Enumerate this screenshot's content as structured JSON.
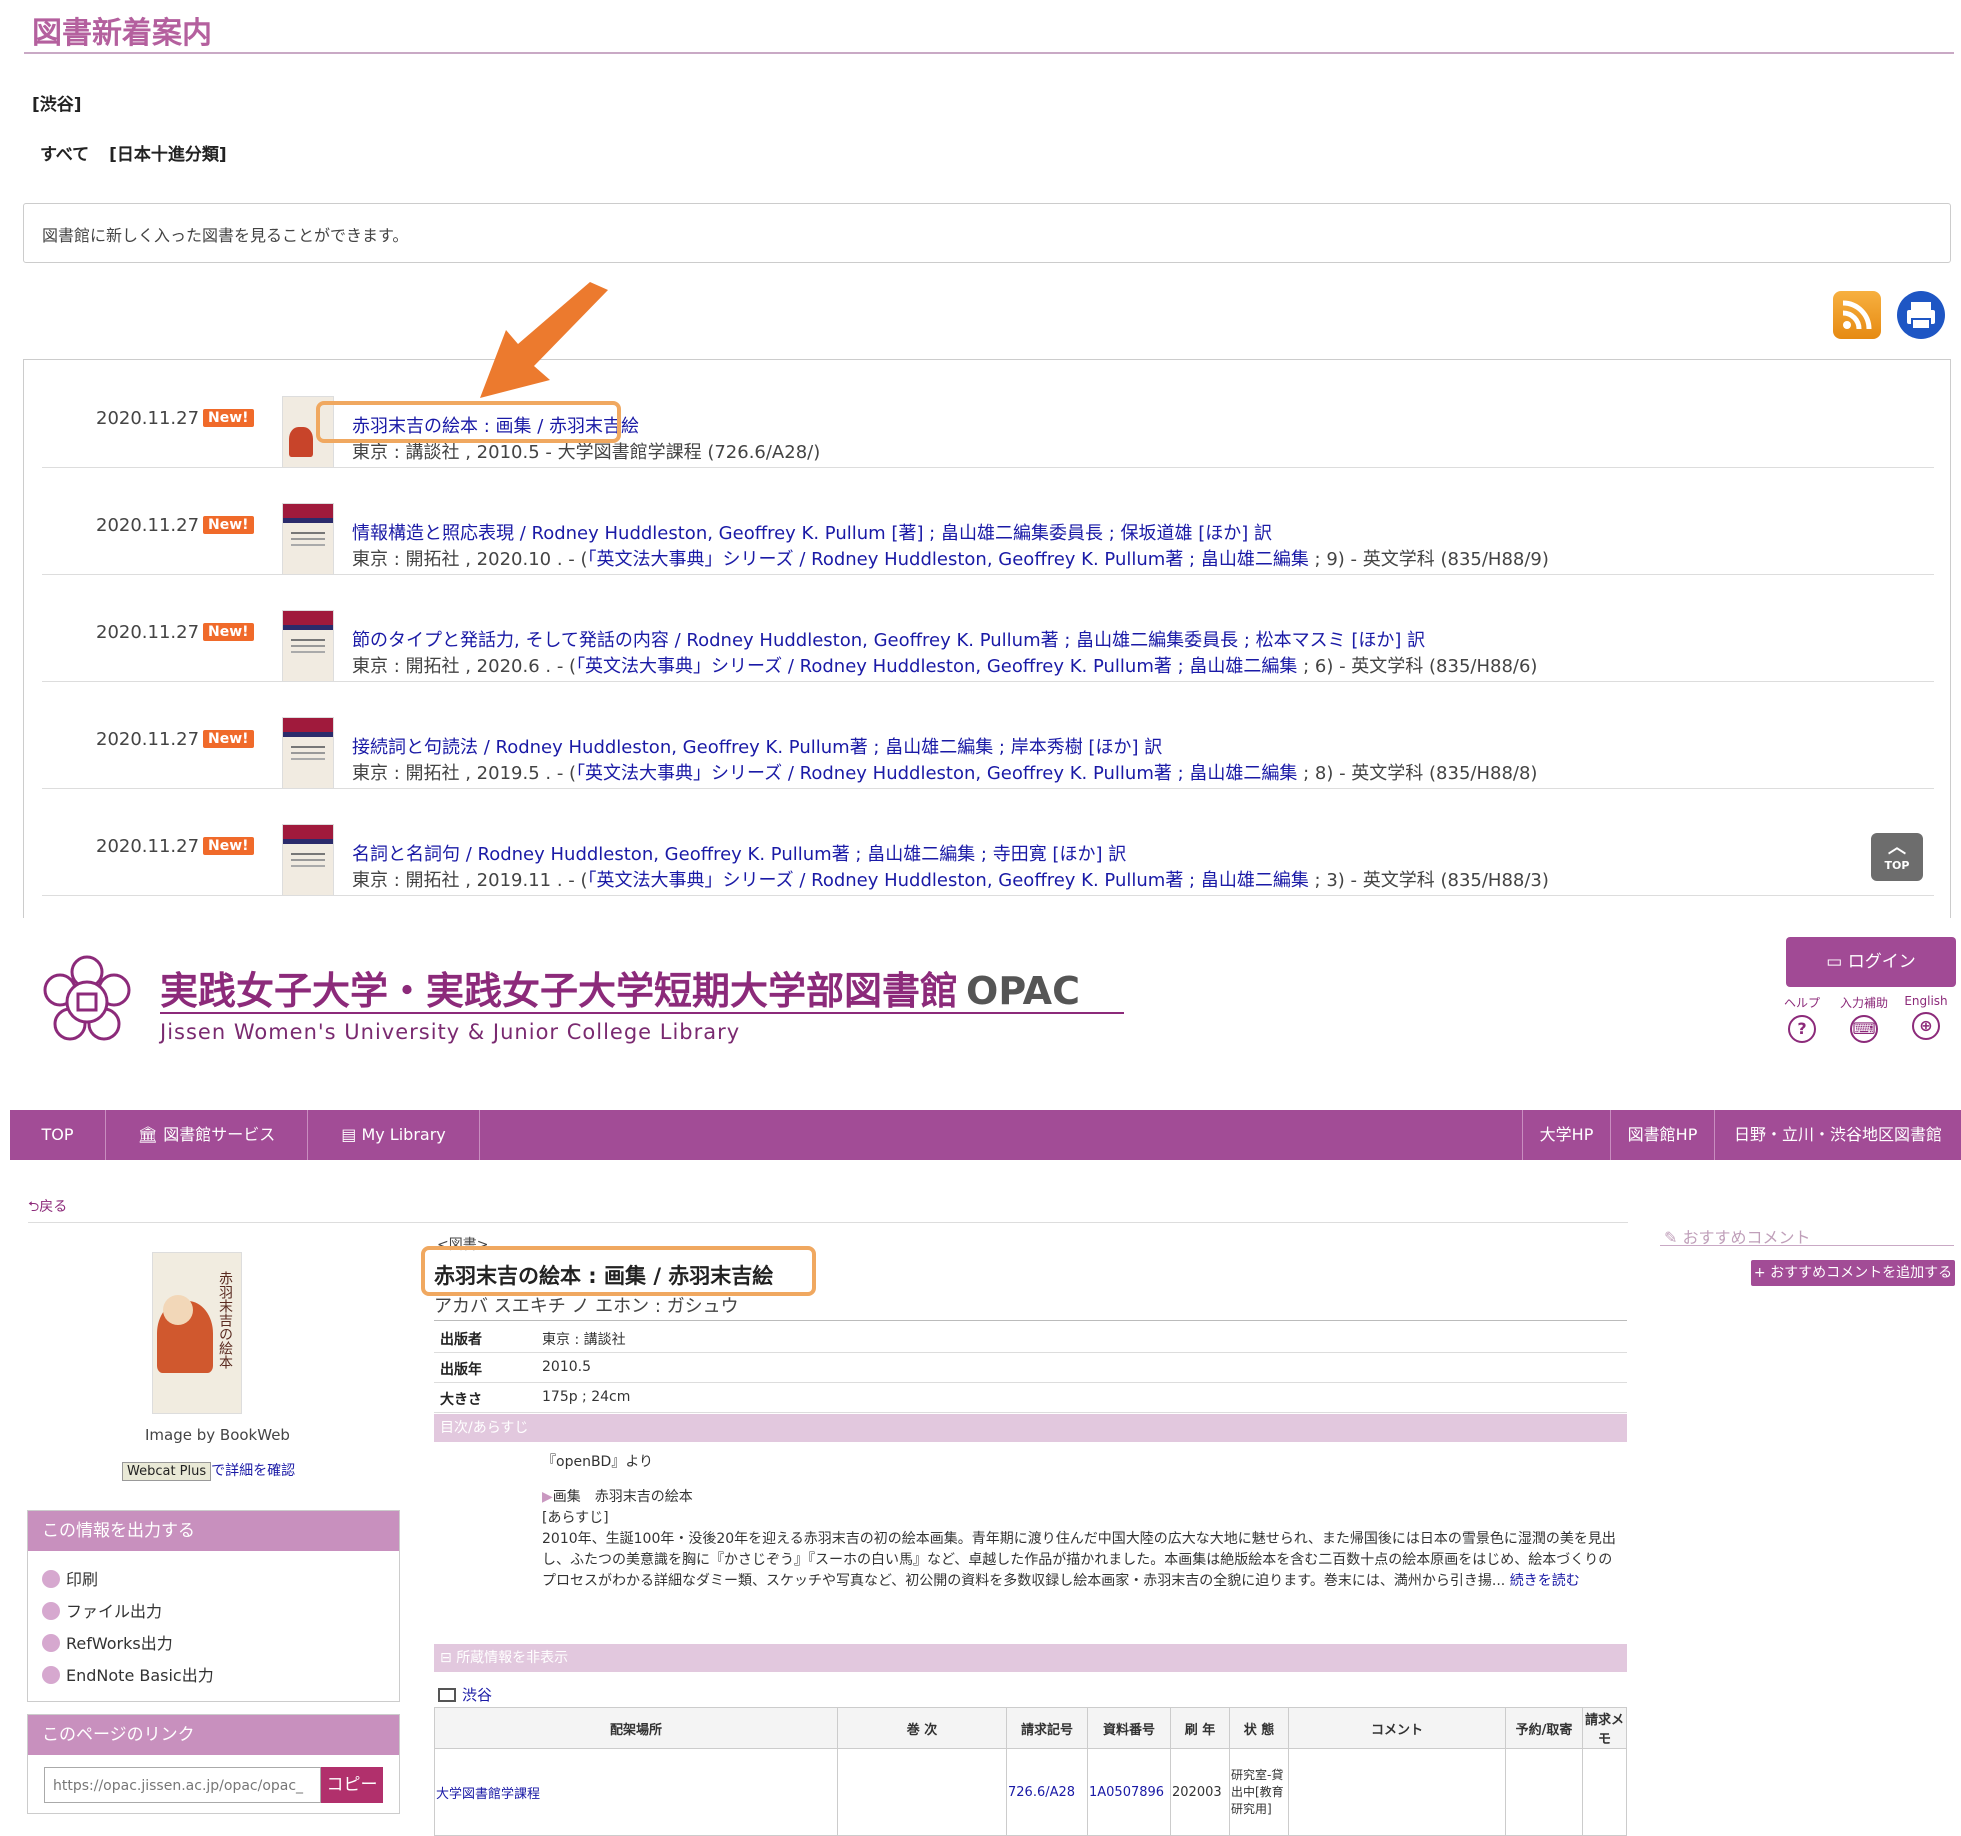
{
  "new_arrivals": {
    "page_title": "図書新着案内",
    "location": "[渋谷]",
    "filter_all": "すべて",
    "filter_class": "[日本十進分類]",
    "description": "図書館に新しく入った図書を見ることができます。",
    "badge": "New!",
    "top_button": "TOP",
    "items": [
      {
        "date": "2020.11.27",
        "title": "赤羽末吉の絵本 : 画集 / 赤羽末吉絵",
        "pub": "東京 : 講談社 , 2010.5 - 大学図書館学課程 (726.6/A28/)",
        "series": "",
        "tail": ""
      },
      {
        "date": "2020.11.27",
        "title": "情報構造と照応表現 / Rodney Huddleston, Geoffrey K. Pullum [著] ; 畠山雄二編集委員長 ; 保坂道雄 [ほか] 訳",
        "pub": "東京 : 開拓社 , 2020.10 . - (",
        "series": "「英文法大事典」シリーズ / Rodney Huddleston, Geoffrey K. Pullum著 ; 畠山雄二編集",
        "tail": " ; 9) - 英文学科 (835/H88/9)"
      },
      {
        "date": "2020.11.27",
        "title": "節のタイプと発話力, そして発話の内容 / Rodney Huddleston, Geoffrey K. Pullum著 ; 畠山雄二編集委員長 ; 松本マスミ [ほか] 訳",
        "pub": "東京 : 開拓社 , 2020.6 . - (",
        "series": "「英文法大事典」シリーズ / Rodney Huddleston, Geoffrey K. Pullum著 ; 畠山雄二編集",
        "tail": " ; 6) - 英文学科 (835/H88/6)"
      },
      {
        "date": "2020.11.27",
        "title": "接続詞と句読法 / Rodney Huddleston, Geoffrey K. Pullum著 ; 畠山雄二編集 ; 岸本秀樹 [ほか] 訳",
        "pub": "東京 : 開拓社 , 2019.5 . - (",
        "series": "「英文法大事典」シリーズ / Rodney Huddleston, Geoffrey K. Pullum著 ; 畠山雄二編集",
        "tail": " ; 8) - 英文学科 (835/H88/8)"
      },
      {
        "date": "2020.11.27",
        "title": "名詞と名詞句 / Rodney Huddleston, Geoffrey K. Pullum著 ; 畠山雄二編集 ; 寺田寛 [ほか] 訳",
        "pub": "東京 : 開拓社 , 2019.11 . - (",
        "series": "「英文法大事典」シリーズ / Rodney Huddleston, Geoffrey K. Pullum著 ; 畠山雄二編集",
        "tail": " ; 3) - 英文学科 (835/H88/3)"
      }
    ]
  },
  "opac": {
    "site_title": "実践女子大学・実践女子大学短期大学部図書館",
    "site_title_opac": "OPAC",
    "site_subtitle": "Jissen Women's University & Junior College Library",
    "login": "ログイン",
    "utils": {
      "help": "ヘルプ",
      "input_assist": "入力補助",
      "english": "English"
    },
    "nav": {
      "top": "TOP",
      "services": "図書館サービス",
      "my_library": "My Library",
      "univ_hp": "大学HP",
      "library_hp": "図書館HP",
      "campus_libs": "日野・立川・渋谷地区図書館"
    },
    "back": "戻る",
    "image_credit": "Image by BookWeb",
    "webcat_badge": "Webcat Plus",
    "webcat_text": "で詳細を確認",
    "output_box": {
      "title": "この情報を出力する",
      "items": [
        "印刷",
        "ファイル出力",
        "RefWorks出力",
        "EndNote Basic出力"
      ]
    },
    "link_box": {
      "title": "このページのリンク",
      "url": "https://opac.jissen.ac.jp/opac/opac_",
      "copy": "コピー"
    },
    "record": {
      "type": "<図書>",
      "title": "赤羽末吉の絵本 : 画集 / 赤羽末吉絵",
      "reading": "アカバ スエキチ ノ エホン : ガシュウ",
      "meta": [
        {
          "key": "出版者",
          "value": "東京 : 講談社"
        },
        {
          "key": "出版年",
          "value": "2010.5"
        },
        {
          "key": "大きさ",
          "value": "175p ; 24cm"
        }
      ],
      "toc_header": "目次/あらすじ",
      "toc_source": "『openBD』より",
      "toc_item": "画集　赤羽末吉の絵本",
      "toc_label": "[あらすじ]",
      "toc_text": "2010年、生誕100年・没後20年を迎える赤羽末吉の初の絵本画集。青年期に渡り住んだ中国大陸の広大な大地に魅せられ、また帰国後には日本の雪景色に湿潤の美を見出し、ふたつの美意識を胸に『かさじぞう』『スーホの白い馬』など、卓越した作品が描かれました。本画集は絶版絵本を含む二百数十点の絵本原画をはじめ、絵本づくりのプロセスがわかる詳細なダミー類、スケッチや写真など、初公開の資料を多数収録し絵本画家・赤羽末吉の全貌に迫ります。巻末には、満州から引き揚...",
      "read_more": "続きを読む",
      "holdings_header": "所蔵情報を非表示",
      "holdings_location": "渋谷",
      "holdings_columns": [
        "配架場所",
        "巻 次",
        "請求記号",
        "資料番号",
        "刷 年",
        "状 態",
        "コメント",
        "予約/取寄",
        "請求メモ"
      ],
      "holdings_row": {
        "shelf": "大学図書館学課程",
        "volume": "",
        "call_no": "726.6/A28",
        "item_no": "1A0507896",
        "year": "202003",
        "status": "研究室-貸出中[教育研究用]",
        "comment": "",
        "reserve": "",
        "memo": ""
      }
    },
    "recommend": {
      "header": "おすすめコメント",
      "add": "+ おすすめコメントを追加する"
    }
  },
  "colors": {
    "accent": "#a24c96",
    "link": "#1a1aa6",
    "new_badge": "#f06a2a",
    "highlight": "#f0a860"
  }
}
